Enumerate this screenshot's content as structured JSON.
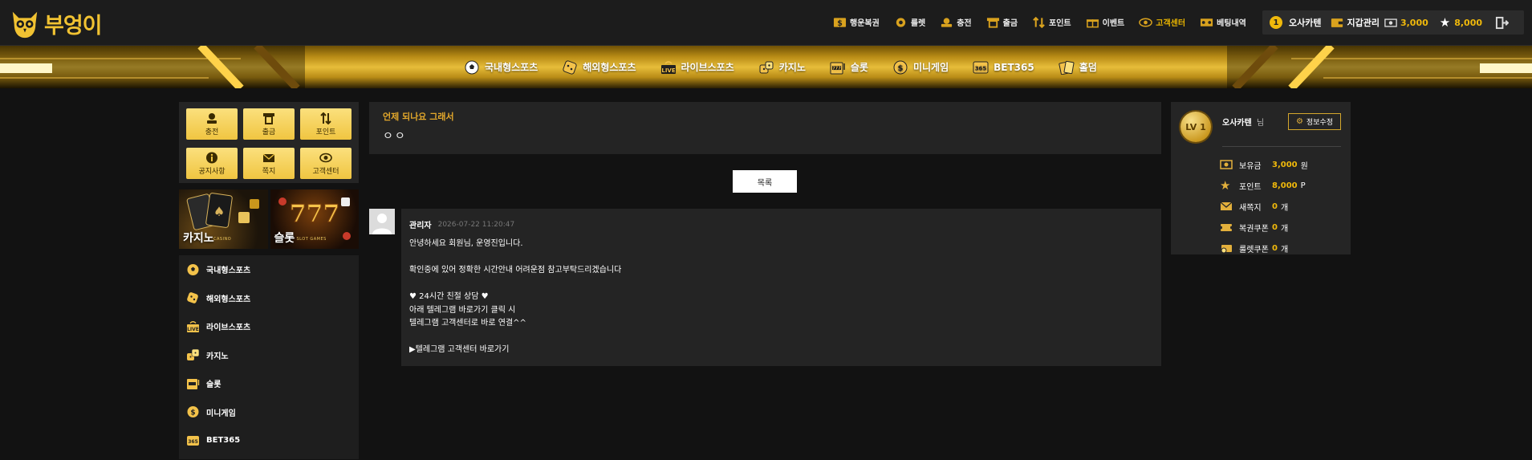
{
  "brand": {
    "name": "부엉이"
  },
  "topnav": [
    {
      "label": "행운복권",
      "icon": "lottery-icon"
    },
    {
      "label": "룰렛",
      "icon": "roulette-icon"
    },
    {
      "label": "충전",
      "icon": "deposit-icon"
    },
    {
      "label": "출금",
      "icon": "withdraw-icon"
    },
    {
      "label": "포인트",
      "icon": "point-icon"
    },
    {
      "label": "이벤트",
      "icon": "gift-icon"
    },
    {
      "label": "고객센터",
      "icon": "eye-icon"
    },
    {
      "label": "베팅내역",
      "icon": "betting-history-icon"
    }
  ],
  "user": {
    "level_badge": "1",
    "name": "오사카텐",
    "wallet_label": "지갑관리",
    "money": "3,000",
    "points": "8,000"
  },
  "gamenav": [
    {
      "label": "국내형스포츠",
      "icon": "soccer-ball-icon"
    },
    {
      "label": "해외형스포츠",
      "icon": "dice-icon"
    },
    {
      "label": "라이브스포츠",
      "icon": "live-icon"
    },
    {
      "label": "카지노",
      "icon": "casino-dice-icon"
    },
    {
      "label": "슬롯",
      "icon": "slot-icon"
    },
    {
      "label": "미니게임",
      "icon": "coin-icon"
    },
    {
      "label": "BET365",
      "icon": "bet365-icon"
    },
    {
      "label": "홀덤",
      "icon": "cards-icon"
    }
  ],
  "quick": [
    {
      "label": "충전",
      "icon": "deposit-icon"
    },
    {
      "label": "출금",
      "icon": "withdraw-icon"
    },
    {
      "label": "포인트",
      "icon": "point-icon"
    },
    {
      "label": "공지사항",
      "icon": "info-icon"
    },
    {
      "label": "쪽지",
      "icon": "mail-icon"
    },
    {
      "label": "고객센터",
      "icon": "eye-icon"
    }
  ],
  "banners": {
    "casino": {
      "title": "카지노",
      "sub": "CASINO"
    },
    "slot": {
      "title": "슬롯",
      "sub": "SLOT GAMES"
    }
  },
  "sidemenu": [
    {
      "label": "국내형스포츠",
      "icon": "soccer-ball-icon"
    },
    {
      "label": "해외형스포츠",
      "icon": "dice-icon"
    },
    {
      "label": "라이브스포츠",
      "icon": "live-icon"
    },
    {
      "label": "카지노",
      "icon": "casino-dice-icon"
    },
    {
      "label": "슬롯",
      "icon": "slot-icon"
    },
    {
      "label": "미니게임",
      "icon": "coin-icon"
    },
    {
      "label": "BET365",
      "icon": "bet365-icon"
    }
  ],
  "post": {
    "title": "언제 되나요 그래서",
    "body": "ㅇㅇ",
    "list_button": "목록"
  },
  "reply": {
    "author": "관리자",
    "date": "2026-07-22 11:20:47",
    "lines": [
      "안녕하세요 회원님, 운영진입니다.",
      "",
      "확인중에 있어 정확한 시간안내 어려운점 참고부탁드리겠습니다",
      "",
      "♥ 24시간 친절 상담 ♥",
      "아래 텔레그램 바로가기 클릭 시",
      "텔레그램 고객센터로 바로 연결^^",
      "",
      "▶텔레그램 고객센터 바로가기"
    ]
  },
  "profile": {
    "level": "LV 1",
    "name": "오사카텐",
    "suffix": "님",
    "edit_label": "정보수정",
    "stats": [
      {
        "label": "보유금",
        "value": "3,000",
        "unit": "원",
        "icon": "cash-icon"
      },
      {
        "label": "포인트",
        "value": "8,000",
        "unit": "P",
        "icon": "star-icon"
      },
      {
        "label": "새쪽지",
        "value": "0",
        "unit": "개",
        "icon": "mail-icon"
      },
      {
        "label": "복권쿠폰",
        "value": "0",
        "unit": "개",
        "icon": "ticket-icon"
      },
      {
        "label": "룰렛쿠폰",
        "value": "0",
        "unit": "개",
        "icon": "coupon-icon"
      }
    ]
  },
  "colors": {
    "accent": "#f0b90b",
    "panel": "#242424",
    "background": "#121212"
  }
}
